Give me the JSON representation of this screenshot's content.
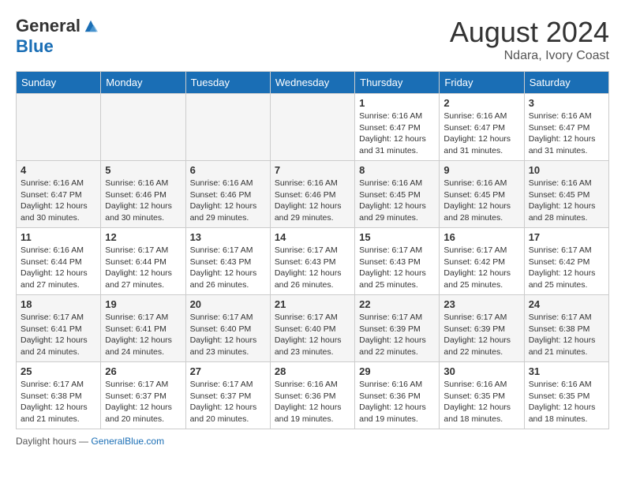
{
  "header": {
    "logo_general": "General",
    "logo_blue": "Blue",
    "month_title": "August 2024",
    "subtitle": "Ndara, Ivory Coast"
  },
  "days_of_week": [
    "Sunday",
    "Monday",
    "Tuesday",
    "Wednesday",
    "Thursday",
    "Friday",
    "Saturday"
  ],
  "weeks": [
    [
      {
        "day": "",
        "info": "",
        "empty": true
      },
      {
        "day": "",
        "info": "",
        "empty": true
      },
      {
        "day": "",
        "info": "",
        "empty": true
      },
      {
        "day": "",
        "info": "",
        "empty": true
      },
      {
        "day": "1",
        "info": "Sunrise: 6:16 AM\nSunset: 6:47 PM\nDaylight: 12 hours\nand 31 minutes."
      },
      {
        "day": "2",
        "info": "Sunrise: 6:16 AM\nSunset: 6:47 PM\nDaylight: 12 hours\nand 31 minutes."
      },
      {
        "day": "3",
        "info": "Sunrise: 6:16 AM\nSunset: 6:47 PM\nDaylight: 12 hours\nand 31 minutes."
      }
    ],
    [
      {
        "day": "4",
        "info": "Sunrise: 6:16 AM\nSunset: 6:47 PM\nDaylight: 12 hours\nand 30 minutes."
      },
      {
        "day": "5",
        "info": "Sunrise: 6:16 AM\nSunset: 6:46 PM\nDaylight: 12 hours\nand 30 minutes."
      },
      {
        "day": "6",
        "info": "Sunrise: 6:16 AM\nSunset: 6:46 PM\nDaylight: 12 hours\nand 29 minutes."
      },
      {
        "day": "7",
        "info": "Sunrise: 6:16 AM\nSunset: 6:46 PM\nDaylight: 12 hours\nand 29 minutes."
      },
      {
        "day": "8",
        "info": "Sunrise: 6:16 AM\nSunset: 6:45 PM\nDaylight: 12 hours\nand 29 minutes."
      },
      {
        "day": "9",
        "info": "Sunrise: 6:16 AM\nSunset: 6:45 PM\nDaylight: 12 hours\nand 28 minutes."
      },
      {
        "day": "10",
        "info": "Sunrise: 6:16 AM\nSunset: 6:45 PM\nDaylight: 12 hours\nand 28 minutes."
      }
    ],
    [
      {
        "day": "11",
        "info": "Sunrise: 6:16 AM\nSunset: 6:44 PM\nDaylight: 12 hours\nand 27 minutes."
      },
      {
        "day": "12",
        "info": "Sunrise: 6:17 AM\nSunset: 6:44 PM\nDaylight: 12 hours\nand 27 minutes."
      },
      {
        "day": "13",
        "info": "Sunrise: 6:17 AM\nSunset: 6:43 PM\nDaylight: 12 hours\nand 26 minutes."
      },
      {
        "day": "14",
        "info": "Sunrise: 6:17 AM\nSunset: 6:43 PM\nDaylight: 12 hours\nand 26 minutes."
      },
      {
        "day": "15",
        "info": "Sunrise: 6:17 AM\nSunset: 6:43 PM\nDaylight: 12 hours\nand 25 minutes."
      },
      {
        "day": "16",
        "info": "Sunrise: 6:17 AM\nSunset: 6:42 PM\nDaylight: 12 hours\nand 25 minutes."
      },
      {
        "day": "17",
        "info": "Sunrise: 6:17 AM\nSunset: 6:42 PM\nDaylight: 12 hours\nand 25 minutes."
      }
    ],
    [
      {
        "day": "18",
        "info": "Sunrise: 6:17 AM\nSunset: 6:41 PM\nDaylight: 12 hours\nand 24 minutes."
      },
      {
        "day": "19",
        "info": "Sunrise: 6:17 AM\nSunset: 6:41 PM\nDaylight: 12 hours\nand 24 minutes."
      },
      {
        "day": "20",
        "info": "Sunrise: 6:17 AM\nSunset: 6:40 PM\nDaylight: 12 hours\nand 23 minutes."
      },
      {
        "day": "21",
        "info": "Sunrise: 6:17 AM\nSunset: 6:40 PM\nDaylight: 12 hours\nand 23 minutes."
      },
      {
        "day": "22",
        "info": "Sunrise: 6:17 AM\nSunset: 6:39 PM\nDaylight: 12 hours\nand 22 minutes."
      },
      {
        "day": "23",
        "info": "Sunrise: 6:17 AM\nSunset: 6:39 PM\nDaylight: 12 hours\nand 22 minutes."
      },
      {
        "day": "24",
        "info": "Sunrise: 6:17 AM\nSunset: 6:38 PM\nDaylight: 12 hours\nand 21 minutes."
      }
    ],
    [
      {
        "day": "25",
        "info": "Sunrise: 6:17 AM\nSunset: 6:38 PM\nDaylight: 12 hours\nand 21 minutes."
      },
      {
        "day": "26",
        "info": "Sunrise: 6:17 AM\nSunset: 6:37 PM\nDaylight: 12 hours\nand 20 minutes."
      },
      {
        "day": "27",
        "info": "Sunrise: 6:17 AM\nSunset: 6:37 PM\nDaylight: 12 hours\nand 20 minutes."
      },
      {
        "day": "28",
        "info": "Sunrise: 6:16 AM\nSunset: 6:36 PM\nDaylight: 12 hours\nand 19 minutes."
      },
      {
        "day": "29",
        "info": "Sunrise: 6:16 AM\nSunset: 6:36 PM\nDaylight: 12 hours\nand 19 minutes."
      },
      {
        "day": "30",
        "info": "Sunrise: 6:16 AM\nSunset: 6:35 PM\nDaylight: 12 hours\nand 18 minutes."
      },
      {
        "day": "31",
        "info": "Sunrise: 6:16 AM\nSunset: 6:35 PM\nDaylight: 12 hours\nand 18 minutes."
      }
    ]
  ],
  "footer": {
    "text": "Daylight hours",
    "source": "GeneralBlue.com"
  },
  "alt_rows": [
    1,
    3
  ]
}
